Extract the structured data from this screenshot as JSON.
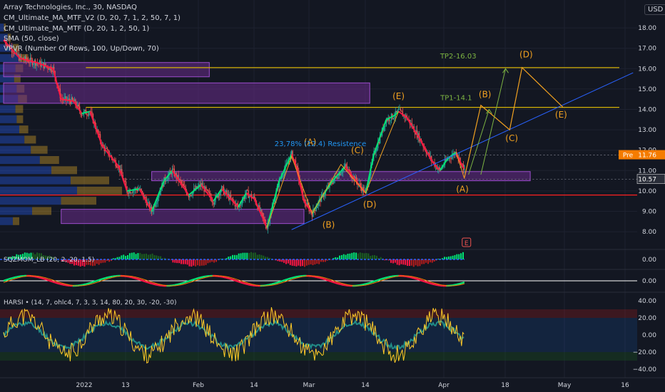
{
  "header": {
    "symbol_line": "Array Technologies, Inc., 30, NASDAQ",
    "indicators": [
      "CM_Ultimate_MA_MTF_V2 (D, 20, 7, 1, 2, 50, 7, 1)",
      "CM_Ultimate_MA_MTF (D, 20, 1, 2, 50, 1)",
      "SMA (50, close)",
      "VPVR (Number Of Rows, 100, Up/Down, 70)"
    ],
    "currency_button": "USD"
  },
  "colors": {
    "background": "#131722",
    "grid": "#1e2230",
    "text": "#d1d4dc",
    "up": "#26a69a",
    "down": "#ef5350",
    "wave": "#f0a020",
    "trend": "#2962ff",
    "level": "#d4b106",
    "support": "#ff2020",
    "zone": "#6a2c8a",
    "target_text": "#7cb342",
    "resistance_text": "#2196f3"
  },
  "chart_data": {
    "type": "candlestick",
    "ylim": [
      7.5,
      18.75
    ],
    "y_ticks": [
      "18.00",
      "17.00",
      "16.00",
      "15.00",
      "14.00",
      "13.00",
      "12.00",
      "11.00",
      "10.00",
      "9.00",
      "8.00"
    ],
    "x_tick_labels": [
      "2022",
      "13",
      "Feb",
      "14",
      "Mar",
      "14",
      "Apr",
      "18",
      "May",
      "16"
    ],
    "price_path": [
      {
        "t": 0,
        "v": 17.4
      },
      {
        "t": 4,
        "v": 16.5
      },
      {
        "t": 8,
        "v": 16.3
      },
      {
        "t": 12,
        "v": 16.0
      },
      {
        "t": 14,
        "v": 14.5
      },
      {
        "t": 17,
        "v": 14.4
      },
      {
        "t": 19,
        "v": 13.8
      },
      {
        "t": 21,
        "v": 13.9
      },
      {
        "t": 24,
        "v": 12.2
      },
      {
        "t": 28,
        "v": 11.2
      },
      {
        "t": 30,
        "v": 10.0
      },
      {
        "t": 33,
        "v": 10.1
      },
      {
        "t": 36,
        "v": 9.0
      },
      {
        "t": 39,
        "v": 10.5
      },
      {
        "t": 41,
        "v": 11.0
      },
      {
        "t": 45,
        "v": 9.8
      },
      {
        "t": 48,
        "v": 10.3
      },
      {
        "t": 51,
        "v": 9.5
      },
      {
        "t": 53,
        "v": 10.1
      },
      {
        "t": 57,
        "v": 9.2
      },
      {
        "t": 59,
        "v": 9.9
      },
      {
        "t": 61,
        "v": 9.6
      },
      {
        "t": 64,
        "v": 8.2
      },
      {
        "t": 67,
        "v": 10.5
      },
      {
        "t": 70,
        "v": 11.8
      },
      {
        "t": 71,
        "v": 11.3
      },
      {
        "t": 73,
        "v": 9.5
      },
      {
        "t": 75,
        "v": 8.9
      },
      {
        "t": 77,
        "v": 9.6
      },
      {
        "t": 80,
        "v": 10.5
      },
      {
        "t": 83,
        "v": 11.2
      },
      {
        "t": 86,
        "v": 10.4
      },
      {
        "t": 88,
        "v": 9.9
      },
      {
        "t": 90,
        "v": 11.8
      },
      {
        "t": 93,
        "v": 13.5
      },
      {
        "t": 95,
        "v": 13.7
      },
      {
        "t": 96,
        "v": 13.9
      },
      {
        "t": 98,
        "v": 13.6
      },
      {
        "t": 101,
        "v": 12.6
      },
      {
        "t": 104,
        "v": 11.5
      },
      {
        "t": 106,
        "v": 11.0
      },
      {
        "t": 108,
        "v": 11.6
      },
      {
        "t": 110,
        "v": 11.9
      },
      {
        "t": 111.5,
        "v": 11.2
      },
      {
        "t": 112,
        "v": 11.1
      }
    ],
    "x_range": [
      0,
      150
    ],
    "horizontal_levels": [
      {
        "value": 16.05,
        "color": "level"
      },
      {
        "value": 14.1,
        "color": "level"
      },
      {
        "value": 9.8,
        "color": "support"
      }
    ],
    "zones": [
      {
        "top": 16.3,
        "bottom": 15.6,
        "t0": 0,
        "t1": 50
      },
      {
        "top": 15.3,
        "bottom": 14.3,
        "t0": 0,
        "t1": 89
      },
      {
        "top": 10.95,
        "bottom": 10.5,
        "t0": 36,
        "t1": 128
      },
      {
        "top": 9.1,
        "bottom": 8.4,
        "t0": 14,
        "t1": 73
      }
    ],
    "trendline": [
      {
        "t": 70,
        "v": 8.1
      },
      {
        "t": 153,
        "v": 15.8
      }
    ],
    "projection_path": [
      {
        "t": 112,
        "v": 10.65
      },
      {
        "t": 116,
        "v": 14.2
      },
      {
        "t": 123,
        "v": 13.0
      },
      {
        "t": 126,
        "v": 16.05
      },
      {
        "t": 136,
        "v": 14.1
      }
    ],
    "wave_lines": [
      [
        {
          "t": 64,
          "v": 8.2
        },
        {
          "t": 70,
          "v": 11.7
        },
        {
          "t": 75,
          "v": 8.9
        },
        {
          "t": 82,
          "v": 11.3
        },
        {
          "t": 88,
          "v": 9.9
        },
        {
          "t": 96,
          "v": 13.9
        }
      ],
      [
        {
          "t": 110,
          "v": 11.9
        },
        {
          "t": 112,
          "v": 10.6
        }
      ]
    ],
    "target_arrows": [
      [
        {
          "t": 113,
          "v": 10.8
        },
        {
          "t": 118,
          "v": 14.0
        }
      ],
      [
        {
          "t": 116,
          "v": 10.8
        },
        {
          "t": 122,
          "v": 16.0
        }
      ]
    ],
    "wave_labels": [
      {
        "text": "(A)",
        "t": 74.5,
        "v": 12.25
      },
      {
        "text": "(B)",
        "t": 79,
        "v": 8.2
      },
      {
        "text": "(C)",
        "t": 86,
        "v": 11.85
      },
      {
        "text": "(D)",
        "t": 89,
        "v": 9.2
      },
      {
        "text": "(E)",
        "t": 96,
        "v": 14.5
      },
      {
        "text": "(A)",
        "t": 111.5,
        "v": 9.95
      },
      {
        "text": "(B)",
        "t": 117,
        "v": 14.6
      },
      {
        "text": "(C)",
        "t": 123.5,
        "v": 12.45
      },
      {
        "text": "(D)",
        "t": 127,
        "v": 16.55
      },
      {
        "text": "(E)",
        "t": 135.5,
        "v": 13.6
      }
    ],
    "annotations": [
      {
        "text": "TP2-16.03",
        "t": 110.5,
        "v": 16.5
      },
      {
        "text": "TP1-14.1",
        "t": 110,
        "v": 14.45
      },
      {
        "text": "23,78% (12.4) Resistence",
        "t": 77,
        "v": 12.2
      }
    ],
    "price_tags": [
      {
        "label": "Pre",
        "value": "11.76",
        "v": 11.76
      },
      {
        "label": "",
        "value": "10.57",
        "v": 10.57
      }
    ],
    "volume_profile": [
      {
        "v": 18.0,
        "up": 6,
        "down": 3
      },
      {
        "v": 17.5,
        "up": 12,
        "down": 5
      },
      {
        "v": 17.0,
        "up": 20,
        "down": 9
      },
      {
        "v": 16.5,
        "up": 30,
        "down": 14
      },
      {
        "v": 16.0,
        "up": 24,
        "down": 12
      },
      {
        "v": 15.5,
        "up": 22,
        "down": 10
      },
      {
        "v": 15.0,
        "up": 26,
        "down": 12
      },
      {
        "v": 14.5,
        "up": 28,
        "down": 14
      },
      {
        "v": 14.0,
        "up": 24,
        "down": 12
      },
      {
        "v": 13.5,
        "up": 26,
        "down": 10
      },
      {
        "v": 13.0,
        "up": 30,
        "down": 14
      },
      {
        "v": 12.5,
        "up": 38,
        "down": 18
      },
      {
        "v": 12.0,
        "up": 48,
        "down": 26
      },
      {
        "v": 11.5,
        "up": 62,
        "down": 30
      },
      {
        "v": 11.0,
        "up": 80,
        "down": 40
      },
      {
        "v": 10.5,
        "up": 110,
        "down": 60
      },
      {
        "v": 10.0,
        "up": 120,
        "down": 70
      },
      {
        "v": 9.5,
        "up": 95,
        "down": 55
      },
      {
        "v": 9.0,
        "up": 50,
        "down": 30
      },
      {
        "v": 8.5,
        "up": 20,
        "down": 10
      }
    ],
    "oscillator_panes": [
      {
        "title": "SQZMOM_LB (20, 2, 20, 1.5)",
        "zero_label": "0.00"
      },
      {
        "title": "",
        "zero_label": "0.00"
      },
      {
        "title": "HARSI • (14, 7, ohlc4, 7, 3, 3, 14, 80, 20, 30, -20, -30)",
        "ticks": [
          "40.00",
          "20.00",
          "0.00",
          "−20.00",
          "−40.00"
        ]
      }
    ],
    "event_badge": "E"
  }
}
